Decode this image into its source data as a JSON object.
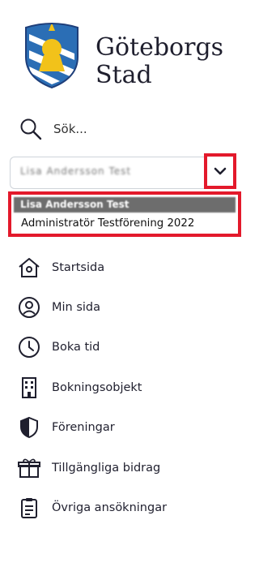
{
  "brand": {
    "name": "Göteborgs\nStad"
  },
  "search": {
    "label": "Sök..."
  },
  "org_select": {
    "current_value": "Lisa Andersson Test"
  },
  "dropdown": {
    "options": [
      "Lisa Andersson Test",
      "Administratör Testförening 2022"
    ]
  },
  "nav": {
    "items": [
      {
        "label": "Startsida",
        "icon": "home-icon"
      },
      {
        "label": "Min sida",
        "icon": "user-icon"
      },
      {
        "label": "Boka tid",
        "icon": "clock-icon"
      },
      {
        "label": "Bokningsobjekt",
        "icon": "building-icon"
      },
      {
        "label": "Föreningar",
        "icon": "shield-icon"
      },
      {
        "label": "Tillgängliga bidrag",
        "icon": "gift-icon"
      },
      {
        "label": "Övriga ansökningar",
        "icon": "clipboard-icon"
      }
    ]
  },
  "colors": {
    "accent_red": "#e3192b",
    "emblem_blue": "#2b6eb5",
    "emblem_gold": "#f2c21a",
    "text": "#1f1f2e"
  }
}
